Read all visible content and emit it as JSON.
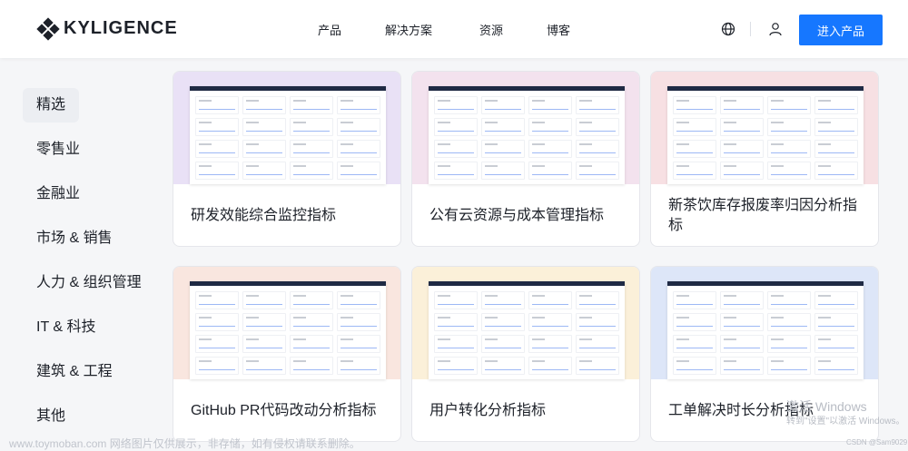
{
  "brand": {
    "name": "KYLIGENCE"
  },
  "nav": {
    "items": [
      "产品",
      "解决方案",
      "资源",
      "博客"
    ]
  },
  "header": {
    "cta_label": "进入产品"
  },
  "sidebar": {
    "items": [
      "精选",
      "零售业",
      "金融业",
      "市场 & 销售",
      "人力 & 组织管理",
      "IT & 科技",
      "建筑 & 工程",
      "其他"
    ]
  },
  "cards": [
    {
      "title": "研发效能综合监控指标",
      "thumb_color": "#e9e1f6"
    },
    {
      "title": "公有云资源与成本管理指标",
      "thumb_color": "#f3e2ee"
    },
    {
      "title": "新茶饮库存报废率归因分析指标",
      "thumb_color": "#f7e0e3"
    },
    {
      "title": "GitHub PR代码改动分析指标",
      "thumb_color": "#f9e6df"
    },
    {
      "title": "用户转化分析指标",
      "thumb_color": "#fbf0d9"
    },
    {
      "title": "工单解决时长分析指标",
      "thumb_color": "#dde6f8"
    }
  ],
  "overlay": {
    "watermark": "www.toymoban.com 网络图片仅供展示，非存储，如有侵权请联系删除。",
    "windows_title": "激活 Windows",
    "windows_sub": "转到\"设置\"以激活 Windows。",
    "csdn": "CSDN @Sam9029"
  },
  "colors": {
    "accent": "#1677ff",
    "text": "#1d2129",
    "bg": "#f5f6f8"
  }
}
